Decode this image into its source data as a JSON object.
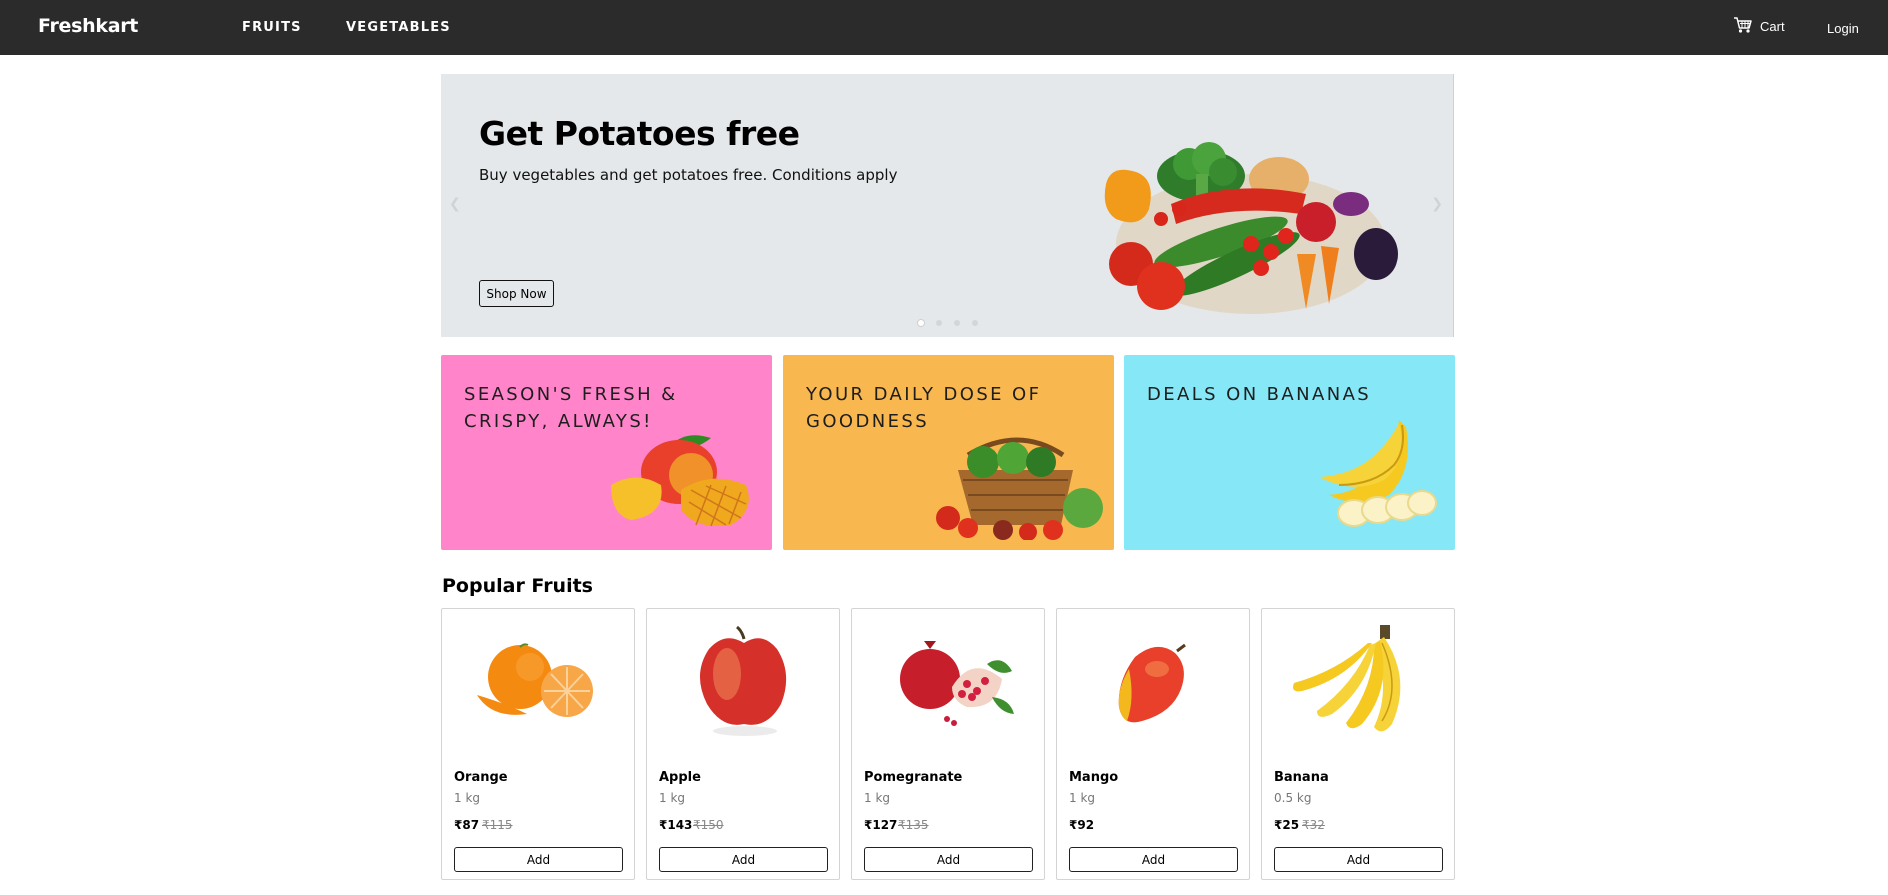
{
  "navbar": {
    "brand": "Freshkart",
    "links": [
      "FRUITS",
      "VEGETABLES"
    ],
    "cart_label": "Cart",
    "cart_icon": "cart-icon",
    "login_label": "Login",
    "background": "#2b2b2b"
  },
  "hero": {
    "title": "Get Potatoes free",
    "subtitle": "Buy vegetables and get potatoes free. Conditions apply",
    "button_label": "Shop Now",
    "slides_count": 4,
    "active_slide": 1,
    "image": "vegetables-pile",
    "background": "#e5e8ea"
  },
  "promos": [
    {
      "text": "SEASON'S FRESH & CRISPY, ALWAYS!",
      "color": "#ff84c9",
      "image": "mango"
    },
    {
      "text": "YOUR DAILY DOSE OF GOODNESS",
      "color": "#f8b84f",
      "image": "vegetable-basket"
    },
    {
      "text": "DEALS ON BANANAS",
      "color": "#86e7f7",
      "image": "bananas"
    }
  ],
  "popular": {
    "title": "Popular Fruits",
    "add_label": "Add",
    "products": [
      {
        "name": "Orange",
        "qty": "1 kg",
        "price": "₹87",
        "old_price": "₹115",
        "image": "orange"
      },
      {
        "name": "Apple",
        "qty": "1 kg",
        "price": "₹143",
        "old_price": "₹150",
        "image": "apple"
      },
      {
        "name": "Pomegranate",
        "qty": "1 kg",
        "price": "₹127",
        "old_price": "₹135",
        "image": "pomegranate"
      },
      {
        "name": "Mango",
        "qty": "1 kg",
        "price": "₹92",
        "old_price": "",
        "image": "mango"
      },
      {
        "name": "Banana",
        "qty": "0.5 kg",
        "price": "₹25",
        "old_price": "₹32",
        "image": "banana"
      }
    ]
  }
}
